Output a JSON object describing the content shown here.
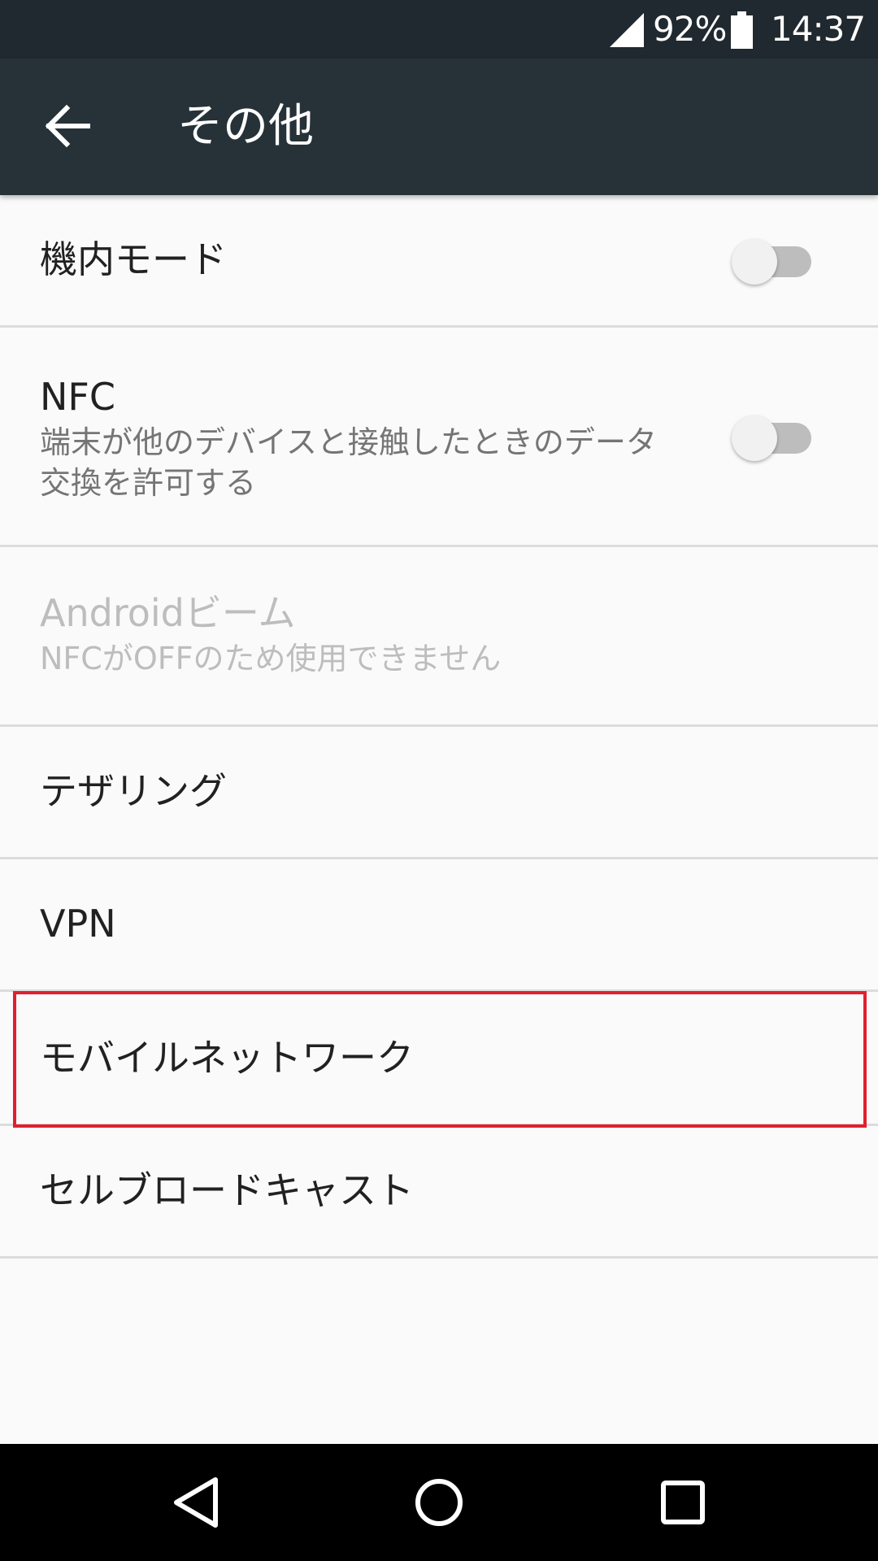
{
  "status_bar": {
    "battery_percent": "92%",
    "time": "14:37",
    "signal_icon": "signal-icon",
    "battery_icon": "battery-icon"
  },
  "app_bar": {
    "title": "その他",
    "back_icon": "arrow-back-icon"
  },
  "settings": [
    {
      "label": "機内モード",
      "toggle": false
    },
    {
      "label": "NFC",
      "summary": "端末が他のデバイスと接触したときのデータ交換を許可する",
      "toggle": false
    },
    {
      "label": "Androidビーム",
      "summary": "NFCがOFFのため使用できません",
      "disabled": true
    },
    {
      "label": "テザリング"
    },
    {
      "label": "VPN"
    },
    {
      "label": "モバイルネットワーク",
      "highlighted": true
    },
    {
      "label": "セルブロードキャスト"
    }
  ],
  "nav_bar": {
    "back_icon": "nav-back-icon",
    "home_icon": "nav-home-icon",
    "recents_icon": "nav-recents-icon"
  },
  "colors": {
    "status_bar": "#20292f",
    "app_bar": "#263238",
    "background": "#fafafa",
    "divider": "#dcdcdc",
    "highlight": "#e0202f"
  }
}
